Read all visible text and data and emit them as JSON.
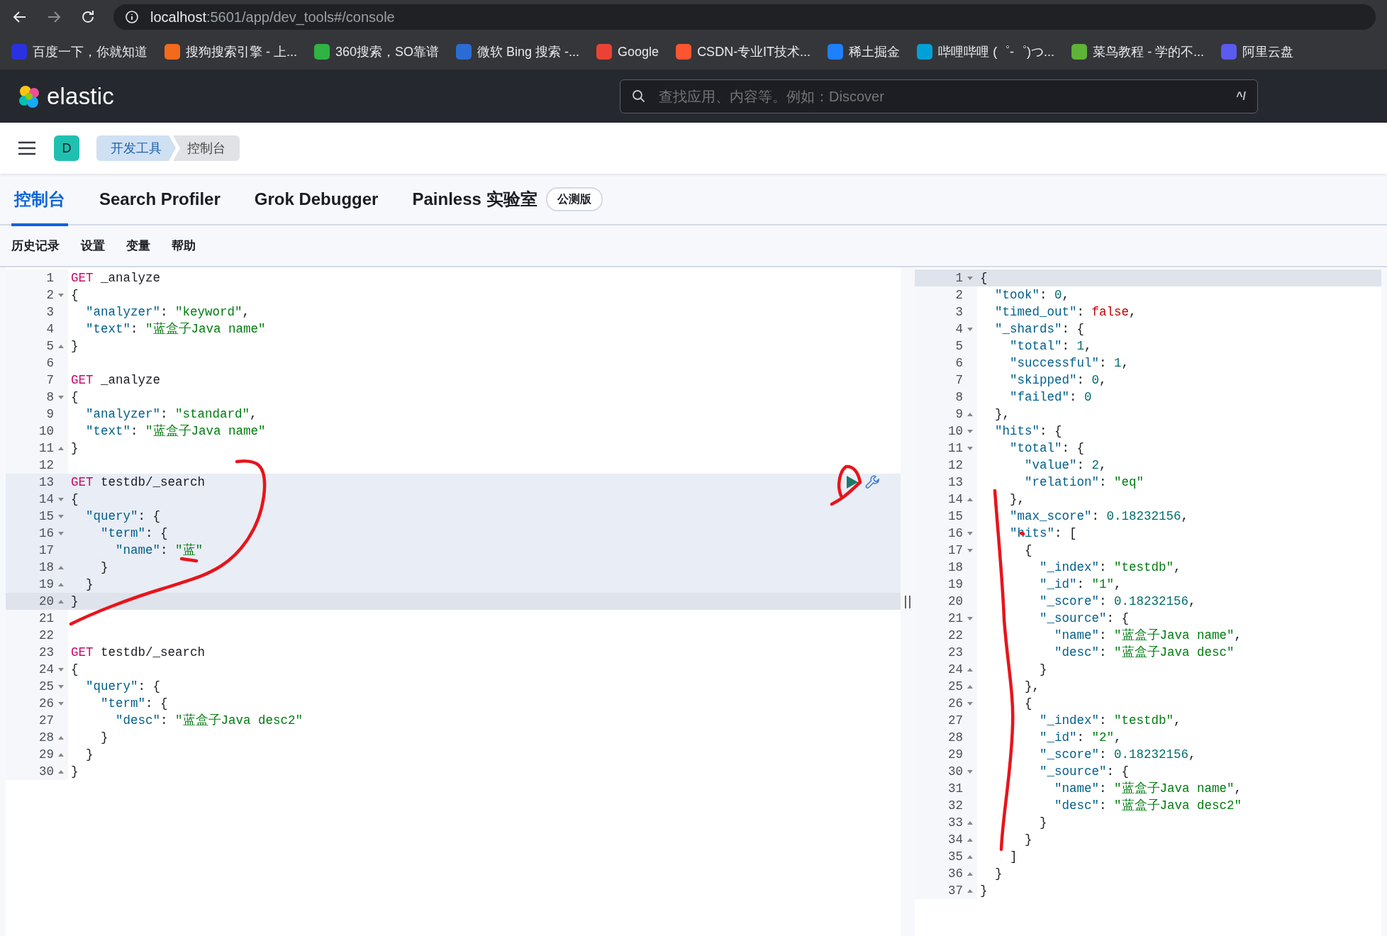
{
  "browser": {
    "url_host": "localhost",
    "url_path": ":5601/app/dev_tools#/console",
    "bookmarks": [
      {
        "label": "百度一下，你就知道",
        "color": "#2932e1"
      },
      {
        "label": "搜狗搜索引擎 - 上...",
        "color": "#f26b1d"
      },
      {
        "label": "360搜索，SO靠谱",
        "color": "#2fb343"
      },
      {
        "label": "微软 Bing 搜索 -...",
        "color": "#2b6cd4"
      },
      {
        "label": "Google",
        "color": "#ea4335"
      },
      {
        "label": "CSDN-专业IT技术...",
        "color": "#fc5531"
      },
      {
        "label": "稀土掘金",
        "color": "#1e80ff"
      },
      {
        "label": "哔哩哔哩 (゜-゜)つ...",
        "color": "#00a1d6"
      },
      {
        "label": "菜鸟教程 - 学的不...",
        "color": "#5fb336"
      },
      {
        "label": "阿里云盘",
        "color": "#5b5bf0"
      }
    ]
  },
  "header": {
    "brand": "elastic",
    "search": {
      "placeholder": "查找应用、内容等。例如：Discover",
      "shortcut": "^/"
    }
  },
  "breadcrumbs": {
    "avatar": "D",
    "items": [
      {
        "label": "开发工具",
        "selected": false
      },
      {
        "label": "控制台",
        "selected": true
      }
    ]
  },
  "tabs": [
    {
      "label": "控制台",
      "selected": true
    },
    {
      "label": "Search Profiler",
      "selected": false
    },
    {
      "label": "Grok Debugger",
      "selected": false
    },
    {
      "label": "Painless 实验室",
      "selected": false,
      "badge": "公测版"
    }
  ],
  "toolbar": [
    "历史记录",
    "设置",
    "变量",
    "帮助"
  ],
  "request_editor": {
    "lines": [
      {
        "num": "1",
        "tokens": [
          {
            "kind": "method",
            "text": "GET"
          },
          {
            "kind": "url",
            "text": " _analyze"
          }
        ]
      },
      {
        "num": "2",
        "fold_start": true,
        "tokens": [
          {
            "kind": "punct",
            "text": "{"
          }
        ]
      },
      {
        "num": "3",
        "tokens": [
          {
            "kind": "key",
            "text": "  \"analyzer\""
          },
          {
            "kind": "punct",
            "text": ": "
          },
          {
            "kind": "string",
            "text": "\"keyword\""
          },
          {
            "kind": "punct",
            "text": ","
          }
        ]
      },
      {
        "num": "4",
        "tokens": [
          {
            "kind": "key",
            "text": "  \"text\""
          },
          {
            "kind": "punct",
            "text": ": "
          },
          {
            "kind": "string",
            "text": "\"蓝盒子Java name\""
          }
        ]
      },
      {
        "num": "5",
        "fold_end": true,
        "tokens": [
          {
            "kind": "punct",
            "text": "}"
          }
        ]
      },
      {
        "num": "6"
      },
      {
        "num": "7",
        "tokens": [
          {
            "kind": "method",
            "text": "GET"
          },
          {
            "kind": "url",
            "text": " _analyze"
          }
        ]
      },
      {
        "num": "8",
        "fold_start": true,
        "tokens": [
          {
            "kind": "punct",
            "text": "{"
          }
        ]
      },
      {
        "num": "9",
        "tokens": [
          {
            "kind": "key",
            "text": "  \"analyzer\""
          },
          {
            "kind": "punct",
            "text": ": "
          },
          {
            "kind": "string",
            "text": "\"standard\""
          },
          {
            "kind": "punct",
            "text": ","
          }
        ]
      },
      {
        "num": "10",
        "tokens": [
          {
            "kind": "key",
            "text": "  \"text\""
          },
          {
            "kind": "punct",
            "text": ": "
          },
          {
            "kind": "string",
            "text": "\"蓝盒子Java name\""
          }
        ]
      },
      {
        "num": "11",
        "fold_end": true,
        "tokens": [
          {
            "kind": "punct",
            "text": "}"
          }
        ]
      },
      {
        "num": "12"
      },
      {
        "num": "13",
        "highlighted": true,
        "run_actions": true,
        "tokens": [
          {
            "kind": "method",
            "text": "GET"
          },
          {
            "kind": "url",
            "text": " testdb/_search"
          }
        ]
      },
      {
        "num": "14",
        "highlighted": true,
        "fold_start": true,
        "tokens": [
          {
            "kind": "punct",
            "text": "{"
          }
        ]
      },
      {
        "num": "15",
        "highlighted": true,
        "fold_start": true,
        "tokens": [
          {
            "kind": "key",
            "text": "  \"query\""
          },
          {
            "kind": "punct",
            "text": ": {"
          }
        ]
      },
      {
        "num": "16",
        "highlighted": true,
        "fold_start": true,
        "tokens": [
          {
            "kind": "key",
            "text": "    \"term\""
          },
          {
            "kind": "punct",
            "text": ": {"
          }
        ]
      },
      {
        "num": "17",
        "highlighted": true,
        "tokens": [
          {
            "kind": "key",
            "text": "      \"name\""
          },
          {
            "kind": "punct",
            "text": ": "
          },
          {
            "kind": "string",
            "text": "\"蓝\""
          }
        ]
      },
      {
        "num": "18",
        "highlighted": true,
        "fold_end": true,
        "tokens": [
          {
            "kind": "punct",
            "text": "    }"
          }
        ]
      },
      {
        "num": "19",
        "highlighted": true,
        "fold_end": true,
        "tokens": [
          {
            "kind": "punct",
            "text": "  }"
          }
        ]
      },
      {
        "num": "20",
        "highlighted": true,
        "cursor": true,
        "fold_end": true,
        "tokens": [
          {
            "kind": "punct",
            "text": "}"
          }
        ]
      },
      {
        "num": "21"
      },
      {
        "num": "22"
      },
      {
        "num": "23",
        "tokens": [
          {
            "kind": "method",
            "text": "GET"
          },
          {
            "kind": "url",
            "text": " testdb/_search"
          }
        ]
      },
      {
        "num": "24",
        "fold_start": true,
        "tokens": [
          {
            "kind": "punct",
            "text": "{"
          }
        ]
      },
      {
        "num": "25",
        "fold_start": true,
        "tokens": [
          {
            "kind": "key",
            "text": "  \"query\""
          },
          {
            "kind": "punct",
            "text": ": {"
          }
        ]
      },
      {
        "num": "26",
        "fold_start": true,
        "tokens": [
          {
            "kind": "key",
            "text": "    \"term\""
          },
          {
            "kind": "punct",
            "text": ": {"
          }
        ]
      },
      {
        "num": "27",
        "tokens": [
          {
            "kind": "key",
            "text": "      \"desc\""
          },
          {
            "kind": "punct",
            "text": ": "
          },
          {
            "kind": "string",
            "text": "\"蓝盒子Java desc2\""
          }
        ]
      },
      {
        "num": "28",
        "fold_end": true,
        "tokens": [
          {
            "kind": "punct",
            "text": "    }"
          }
        ]
      },
      {
        "num": "29",
        "fold_end": true,
        "tokens": [
          {
            "kind": "punct",
            "text": "  }"
          }
        ]
      },
      {
        "num": "30",
        "fold_end": true,
        "tokens": [
          {
            "kind": "punct",
            "text": "}"
          }
        ]
      }
    ]
  },
  "response_editor": {
    "lines": [
      {
        "num": "1",
        "cursor": true,
        "fold_start": true,
        "tokens": [
          {
            "kind": "punct",
            "text": "{"
          }
        ]
      },
      {
        "num": "2",
        "tokens": [
          {
            "kind": "key",
            "text": "  \"took\""
          },
          {
            "kind": "punct",
            "text": ": "
          },
          {
            "kind": "number",
            "text": "0"
          },
          {
            "kind": "punct",
            "text": ","
          }
        ]
      },
      {
        "num": "3",
        "tokens": [
          {
            "kind": "key",
            "text": "  \"timed_out\""
          },
          {
            "kind": "punct",
            "text": ": "
          },
          {
            "kind": "bool",
            "text": "false"
          },
          {
            "kind": "punct",
            "text": ","
          }
        ]
      },
      {
        "num": "4",
        "fold_start": true,
        "tokens": [
          {
            "kind": "key",
            "text": "  \"_shards\""
          },
          {
            "kind": "punct",
            "text": ": {"
          }
        ]
      },
      {
        "num": "5",
        "tokens": [
          {
            "kind": "key",
            "text": "    \"total\""
          },
          {
            "kind": "punct",
            "text": ": "
          },
          {
            "kind": "number",
            "text": "1"
          },
          {
            "kind": "punct",
            "text": ","
          }
        ]
      },
      {
        "num": "6",
        "tokens": [
          {
            "kind": "key",
            "text": "    \"successful\""
          },
          {
            "kind": "punct",
            "text": ": "
          },
          {
            "kind": "number",
            "text": "1"
          },
          {
            "kind": "punct",
            "text": ","
          }
        ]
      },
      {
        "num": "7",
        "tokens": [
          {
            "kind": "key",
            "text": "    \"skipped\""
          },
          {
            "kind": "punct",
            "text": ": "
          },
          {
            "kind": "number",
            "text": "0"
          },
          {
            "kind": "punct",
            "text": ","
          }
        ]
      },
      {
        "num": "8",
        "tokens": [
          {
            "kind": "key",
            "text": "    \"failed\""
          },
          {
            "kind": "punct",
            "text": ": "
          },
          {
            "kind": "number",
            "text": "0"
          }
        ]
      },
      {
        "num": "9",
        "fold_end": true,
        "tokens": [
          {
            "kind": "punct",
            "text": "  },"
          }
        ]
      },
      {
        "num": "10",
        "fold_start": true,
        "tokens": [
          {
            "kind": "key",
            "text": "  \"hits\""
          },
          {
            "kind": "punct",
            "text": ": {"
          }
        ]
      },
      {
        "num": "11",
        "fold_start": true,
        "tokens": [
          {
            "kind": "key",
            "text": "    \"total\""
          },
          {
            "kind": "punct",
            "text": ": {"
          }
        ]
      },
      {
        "num": "12",
        "tokens": [
          {
            "kind": "key",
            "text": "      \"value\""
          },
          {
            "kind": "punct",
            "text": ": "
          },
          {
            "kind": "number",
            "text": "2"
          },
          {
            "kind": "punct",
            "text": ","
          }
        ]
      },
      {
        "num": "13",
        "tokens": [
          {
            "kind": "key",
            "text": "      \"relation\""
          },
          {
            "kind": "punct",
            "text": ": "
          },
          {
            "kind": "string",
            "text": "\"eq\""
          }
        ]
      },
      {
        "num": "14",
        "fold_end": true,
        "tokens": [
          {
            "kind": "punct",
            "text": "    },"
          }
        ]
      },
      {
        "num": "15",
        "tokens": [
          {
            "kind": "key",
            "text": "    \"max_score\""
          },
          {
            "kind": "punct",
            "text": ": "
          },
          {
            "kind": "number",
            "text": "0.18232156"
          },
          {
            "kind": "punct",
            "text": ","
          }
        ]
      },
      {
        "num": "16",
        "fold_start": true,
        "tokens": [
          {
            "kind": "key",
            "text": "    \"hits\""
          },
          {
            "kind": "punct",
            "text": ": ["
          }
        ]
      },
      {
        "num": "17",
        "fold_start": true,
        "tokens": [
          {
            "kind": "punct",
            "text": "      {"
          }
        ]
      },
      {
        "num": "18",
        "tokens": [
          {
            "kind": "key",
            "text": "        \"_index\""
          },
          {
            "kind": "punct",
            "text": ": "
          },
          {
            "kind": "string",
            "text": "\"testdb\""
          },
          {
            "kind": "punct",
            "text": ","
          }
        ]
      },
      {
        "num": "19",
        "tokens": [
          {
            "kind": "key",
            "text": "        \"_id\""
          },
          {
            "kind": "punct",
            "text": ": "
          },
          {
            "kind": "string",
            "text": "\"1\""
          },
          {
            "kind": "punct",
            "text": ","
          }
        ]
      },
      {
        "num": "20",
        "tokens": [
          {
            "kind": "key",
            "text": "        \"_score\""
          },
          {
            "kind": "punct",
            "text": ": "
          },
          {
            "kind": "number",
            "text": "0.18232156"
          },
          {
            "kind": "punct",
            "text": ","
          }
        ]
      },
      {
        "num": "21",
        "fold_start": true,
        "tokens": [
          {
            "kind": "key",
            "text": "        \"_source\""
          },
          {
            "kind": "punct",
            "text": ": {"
          }
        ]
      },
      {
        "num": "22",
        "tokens": [
          {
            "kind": "key",
            "text": "          \"name\""
          },
          {
            "kind": "punct",
            "text": ": "
          },
          {
            "kind": "string",
            "text": "\"蓝盒子Java name\""
          },
          {
            "kind": "punct",
            "text": ","
          }
        ]
      },
      {
        "num": "23",
        "tokens": [
          {
            "kind": "key",
            "text": "          \"desc\""
          },
          {
            "kind": "punct",
            "text": ": "
          },
          {
            "kind": "string",
            "text": "\"蓝盒子Java desc\""
          }
        ]
      },
      {
        "num": "24",
        "fold_end": true,
        "tokens": [
          {
            "kind": "punct",
            "text": "        }"
          }
        ]
      },
      {
        "num": "25",
        "fold_end": true,
        "tokens": [
          {
            "kind": "punct",
            "text": "      },"
          }
        ]
      },
      {
        "num": "26",
        "fold_start": true,
        "tokens": [
          {
            "kind": "punct",
            "text": "      {"
          }
        ]
      },
      {
        "num": "27",
        "tokens": [
          {
            "kind": "key",
            "text": "        \"_index\""
          },
          {
            "kind": "punct",
            "text": ": "
          },
          {
            "kind": "string",
            "text": "\"testdb\""
          },
          {
            "kind": "punct",
            "text": ","
          }
        ]
      },
      {
        "num": "28",
        "tokens": [
          {
            "kind": "key",
            "text": "        \"_id\""
          },
          {
            "kind": "punct",
            "text": ": "
          },
          {
            "kind": "string",
            "text": "\"2\""
          },
          {
            "kind": "punct",
            "text": ","
          }
        ]
      },
      {
        "num": "29",
        "tokens": [
          {
            "kind": "key",
            "text": "        \"_score\""
          },
          {
            "kind": "punct",
            "text": ": "
          },
          {
            "kind": "number",
            "text": "0.18232156"
          },
          {
            "kind": "punct",
            "text": ","
          }
        ]
      },
      {
        "num": "30",
        "fold_start": true,
        "tokens": [
          {
            "kind": "key",
            "text": "        \"_source\""
          },
          {
            "kind": "punct",
            "text": ": {"
          }
        ]
      },
      {
        "num": "31",
        "tokens": [
          {
            "kind": "key",
            "text": "          \"name\""
          },
          {
            "kind": "punct",
            "text": ": "
          },
          {
            "kind": "string",
            "text": "\"蓝盒子Java name\""
          },
          {
            "kind": "punct",
            "text": ","
          }
        ]
      },
      {
        "num": "32",
        "tokens": [
          {
            "kind": "key",
            "text": "          \"desc\""
          },
          {
            "kind": "punct",
            "text": ": "
          },
          {
            "kind": "string",
            "text": "\"蓝盒子Java desc2\""
          }
        ]
      },
      {
        "num": "33",
        "fold_end": true,
        "tokens": [
          {
            "kind": "punct",
            "text": "        }"
          }
        ]
      },
      {
        "num": "34",
        "fold_end": true,
        "tokens": [
          {
            "kind": "punct",
            "text": "      }"
          }
        ]
      },
      {
        "num": "35",
        "fold_end": true,
        "tokens": [
          {
            "kind": "punct",
            "text": "    ]"
          }
        ]
      },
      {
        "num": "36",
        "fold_end": true,
        "tokens": [
          {
            "kind": "punct",
            "text": "  }"
          }
        ]
      },
      {
        "num": "37",
        "fold_end": true,
        "tokens": [
          {
            "kind": "punct",
            "text": "}"
          }
        ]
      }
    ]
  }
}
